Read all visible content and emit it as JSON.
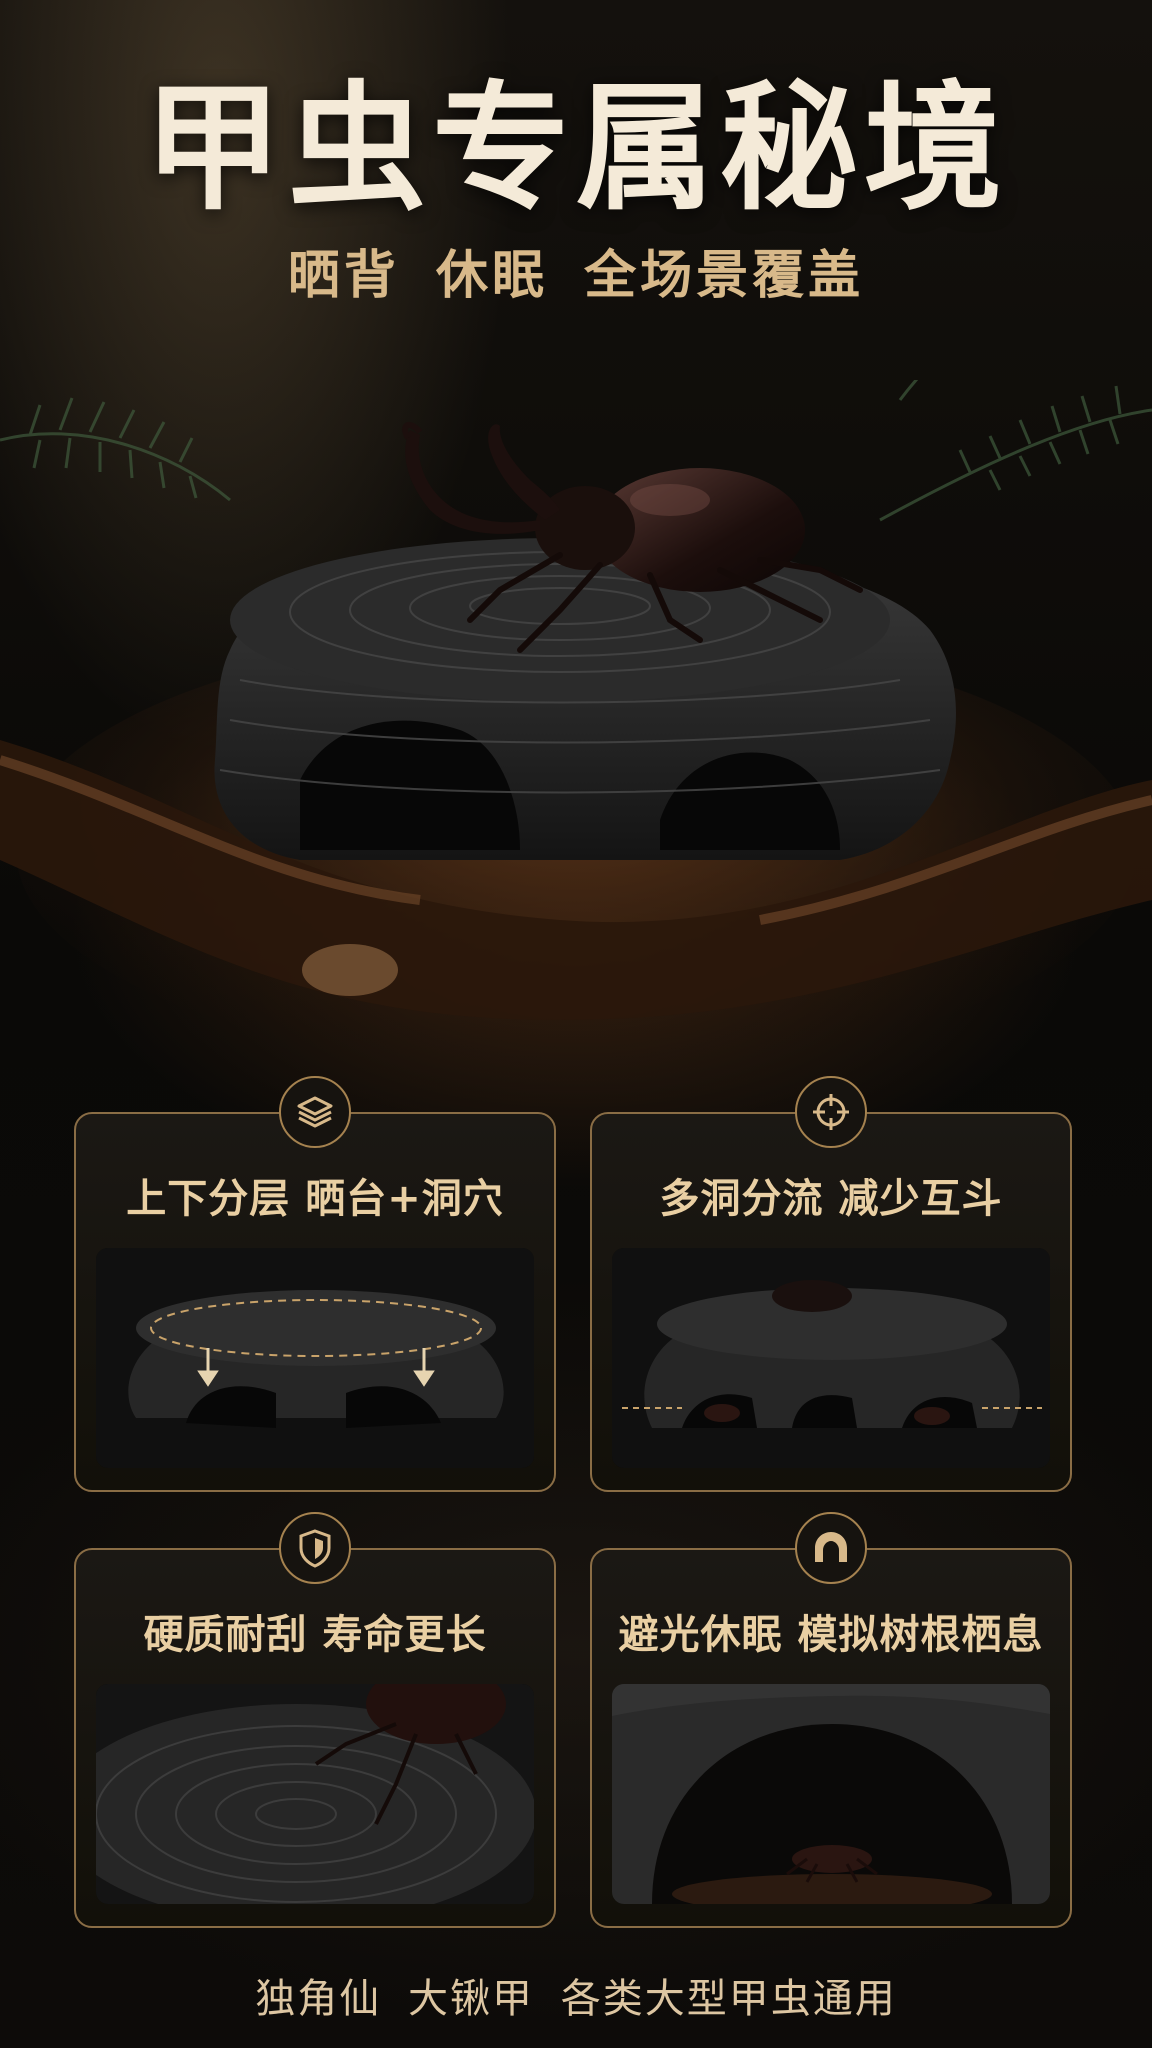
{
  "header": {
    "title": "甲虫专属秘境",
    "subtitle": "晒背 休眠 全场景覆盖"
  },
  "hero": {
    "image_subject": "rhinoceros beetle on black resin cave hide"
  },
  "features": [
    {
      "icon": "layers-icon",
      "title": "上下分层 晒台+洞穴"
    },
    {
      "icon": "crosshair-icon",
      "title": "多洞分流 减少互斗"
    },
    {
      "icon": "shield-icon",
      "title": "硬质耐刮 寿命更长"
    },
    {
      "icon": "arch-icon",
      "title": "避光休眠 模拟树根栖息"
    }
  ],
  "footer": {
    "text": "独角仙 大锹甲 各类大型甲虫通用"
  },
  "colors": {
    "accent": "#a5824f",
    "title": "#f4ead8",
    "subtitle": "#d8b98a",
    "background": "#0b0a08"
  }
}
